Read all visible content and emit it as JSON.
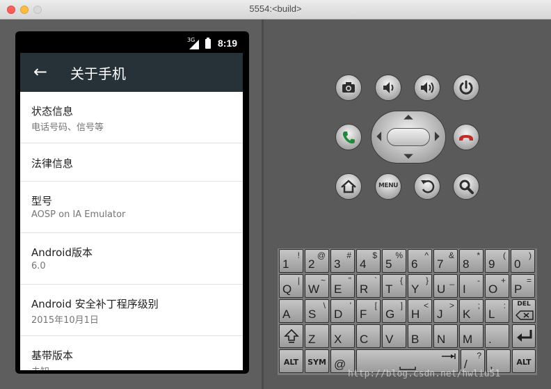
{
  "window": {
    "title": "5554:<build>"
  },
  "status_bar": {
    "network": "3G",
    "time": "8:19"
  },
  "app_bar": {
    "title": "关于手机",
    "back_icon": "arrow-back-icon"
  },
  "settings_items": [
    {
      "title": "状态信息",
      "summary": "电话号码、信号等"
    },
    {
      "title": "法律信息",
      "summary": ""
    },
    {
      "title": "型号",
      "summary": "AOSP on IA Emulator"
    },
    {
      "title": "Android版本",
      "summary": "6.0"
    },
    {
      "title": "Android 安全补丁程序级别",
      "summary": "2015年10月1日"
    },
    {
      "title": "基带版本",
      "summary": "未知"
    }
  ],
  "controls": {
    "top_row": [
      "camera-icon",
      "volume-down-icon",
      "volume-up-icon",
      "power-icon"
    ],
    "bottom_row": [
      "home-icon",
      "menu-button",
      "back-icon",
      "search-icon"
    ],
    "menu_label": "MENU",
    "call_icon": "call-icon",
    "end_call_icon": "end-call-icon"
  },
  "keyboard": {
    "row1": [
      {
        "m": "1",
        "s": "!"
      },
      {
        "m": "2",
        "s": "@"
      },
      {
        "m": "3",
        "s": "#"
      },
      {
        "m": "4",
        "s": "$"
      },
      {
        "m": "5",
        "s": "%"
      },
      {
        "m": "6",
        "s": "^"
      },
      {
        "m": "7",
        "s": "&"
      },
      {
        "m": "8",
        "s": "*"
      },
      {
        "m": "9",
        "s": "("
      },
      {
        "m": "0",
        "s": ")"
      }
    ],
    "row2": [
      {
        "m": "Q",
        "s": "|"
      },
      {
        "m": "W",
        "s": "~"
      },
      {
        "m": "E",
        "s": "\""
      },
      {
        "m": "R",
        "s": "`"
      },
      {
        "m": "T",
        "s": "{"
      },
      {
        "m": "Y",
        "s": "}"
      },
      {
        "m": "U",
        "s": "_"
      },
      {
        "m": "I",
        "s": "-"
      },
      {
        "m": "O",
        "s": "+"
      },
      {
        "m": "P",
        "s": "="
      }
    ],
    "row3": [
      {
        "m": "A",
        "s": ""
      },
      {
        "m": "S",
        "s": "\\"
      },
      {
        "m": "D",
        "s": "'"
      },
      {
        "m": "F",
        "s": "["
      },
      {
        "m": "G",
        "s": "]"
      },
      {
        "m": "H",
        "s": "<"
      },
      {
        "m": "J",
        "s": ">"
      },
      {
        "m": "K",
        "s": ";"
      },
      {
        "m": "L",
        "s": ":"
      }
    ],
    "row4": [
      {
        "m": "Z",
        "s": ""
      },
      {
        "m": "X",
        "s": ""
      },
      {
        "m": "C",
        "s": ""
      },
      {
        "m": "V",
        "s": ""
      },
      {
        "m": "B",
        "s": ""
      },
      {
        "m": "N",
        "s": ""
      },
      {
        "m": "M",
        "s": ""
      },
      {
        "m": ".",
        "s": ""
      }
    ],
    "del_label": "DEL",
    "alt_label": "ALT",
    "sym_label": "SYM",
    "at_label": "@",
    "slash_key": {
      "m": "/",
      "s": "?"
    },
    "comma_key": {
      "m": ",",
      "s": ""
    }
  },
  "watermark": "http://blog.csdn.net/hwliu51"
}
